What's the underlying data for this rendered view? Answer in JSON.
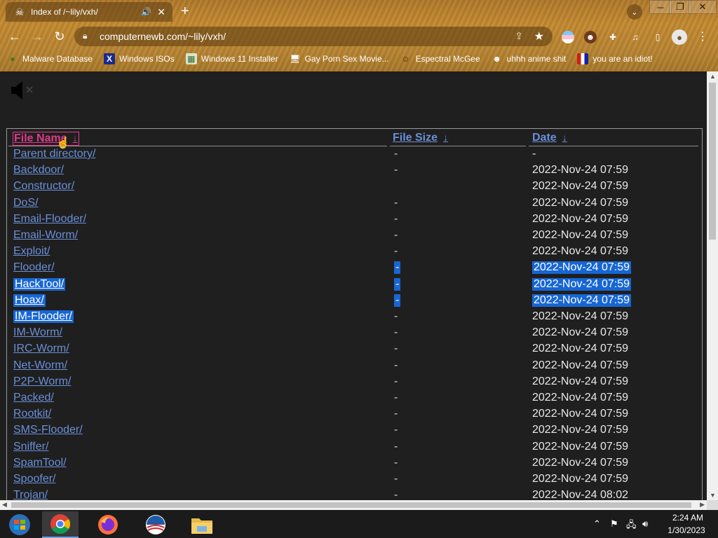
{
  "browser": {
    "tab": {
      "title": "Index of /~lily/vxh/",
      "close_glyph": "✕",
      "audio_glyph": "🔊"
    },
    "new_tab_glyph": "+",
    "url": "computernewb.com/~lily/vxh/",
    "window_controls": {
      "minimize": "─",
      "maximize": "❐",
      "close": "✕"
    },
    "bookmarks": [
      {
        "label": "Malware Database",
        "icon": "globe-icon"
      },
      {
        "label": "Windows ISOs",
        "icon": "x-icon"
      },
      {
        "label": "Windows 11 Installer",
        "icon": "image-icon"
      },
      {
        "label": "Gay Porn Sex Movie...",
        "icon": "monitor-icon"
      },
      {
        "label": "Espectral McGee",
        "icon": "character-icon"
      },
      {
        "label": "uhhh anime shit",
        "icon": "anime-icon"
      },
      {
        "label": "you are an idiot!",
        "icon": "flag-icon"
      }
    ]
  },
  "listing": {
    "headers": {
      "name": "File Name",
      "size": "File Size",
      "date": "Date",
      "sort_arrow": "↓"
    },
    "rows": [
      {
        "name": "Parent directory/",
        "size": "-",
        "date": "-",
        "selected": false
      },
      {
        "name": "Backdoor/",
        "size": "-",
        "date": "2022-Nov-24 07:59",
        "selected": false
      },
      {
        "name": "Constructor/",
        "size": "",
        "date": "2022-Nov-24 07:59",
        "selected": false
      },
      {
        "name": "DoS/",
        "size": "-",
        "date": "2022-Nov-24 07:59",
        "selected": false
      },
      {
        "name": "Email-Flooder/",
        "size": "-",
        "date": "2022-Nov-24 07:59",
        "selected": false
      },
      {
        "name": "Email-Worm/",
        "size": "-",
        "date": "2022-Nov-24 07:59",
        "selected": false
      },
      {
        "name": "Exploit/",
        "size": "-",
        "date": "2022-Nov-24 07:59",
        "selected": false
      },
      {
        "name": "Flooder/",
        "size": "-",
        "date": "2022-Nov-24 07:59",
        "selected": "partial"
      },
      {
        "name": "HackTool/",
        "size": "-",
        "date": "2022-Nov-24 07:59",
        "selected": true
      },
      {
        "name": "Hoax/",
        "size": "-",
        "date": "2022-Nov-24 07:59",
        "selected": true
      },
      {
        "name": "IM-Flooder/",
        "size": "-",
        "date": "2022-Nov-24 07:59",
        "selected": "name"
      },
      {
        "name": "IM-Worm/",
        "size": "-",
        "date": "2022-Nov-24 07:59",
        "selected": false
      },
      {
        "name": "IRC-Worm/",
        "size": "-",
        "date": "2022-Nov-24 07:59",
        "selected": false
      },
      {
        "name": "Net-Worm/",
        "size": "-",
        "date": "2022-Nov-24 07:59",
        "selected": false
      },
      {
        "name": "P2P-Worm/",
        "size": "-",
        "date": "2022-Nov-24 07:59",
        "selected": false
      },
      {
        "name": "Packed/",
        "size": "-",
        "date": "2022-Nov-24 07:59",
        "selected": false
      },
      {
        "name": "Rootkit/",
        "size": "-",
        "date": "2022-Nov-24 07:59",
        "selected": false
      },
      {
        "name": "SMS-Flooder/",
        "size": "-",
        "date": "2022-Nov-24 07:59",
        "selected": false
      },
      {
        "name": "Sniffer/",
        "size": "-",
        "date": "2022-Nov-24 07:59",
        "selected": false
      },
      {
        "name": "SpamTool/",
        "size": "-",
        "date": "2022-Nov-24 07:59",
        "selected": false
      },
      {
        "name": "Spoofer/",
        "size": "-",
        "date": "2022-Nov-24 07:59",
        "selected": false
      },
      {
        "name": "Trojan/",
        "size": "-",
        "date": "2022-Nov-24 08:02",
        "selected": false
      }
    ]
  },
  "taskbar": {
    "apps": [
      "start-icon",
      "chrome-icon",
      "firefox-icon",
      "obama-icon",
      "explorer-icon"
    ],
    "clock": {
      "time": "2:24 AM",
      "date": "1/30/2023"
    }
  },
  "colors": {
    "link": "#6a8fd8",
    "selection": "#1766d4",
    "active_header": "#e03a8a",
    "page_bg": "#1f1f1f"
  }
}
